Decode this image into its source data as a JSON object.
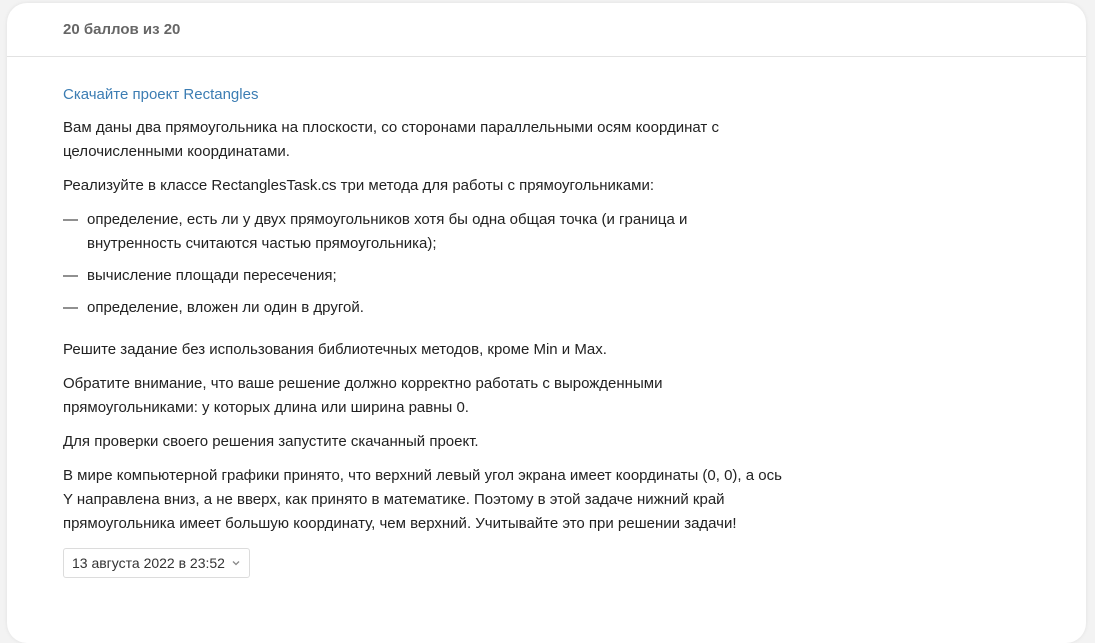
{
  "header": {
    "score": "20 баллов из 20"
  },
  "task": {
    "download_link": "Скачайте проект Rectangles",
    "paragraphs_top": [
      "Вам даны два прямоугольника на плоскости, со сторонами параллельными осям координат с целочисленными координатами.",
      "Реализуйте в классе RectanglesTask.cs три метода для работы с прямоугольниками:"
    ],
    "list_marker": "—",
    "list": [
      "определение, есть ли у двух прямоугольников хотя бы одна общая точка (и граница и внутренность считаются частью прямоугольника);",
      "вычисление площади пересечения;",
      "определение, вложен ли один в другой."
    ],
    "paragraphs_bottom": [
      "Решите задание без использования библиотечных методов, кроме Min и Max.",
      "Обратите внимание, что ваше решение должно корректно работать с вырожденными прямоугольниками: у которых длина или ширина равны 0.",
      "Для проверки своего решения запустите скачанный проект.",
      "В мире компьютерной графики принято, что верхний левый угол экрана имеет координаты (0, 0), а ось Y направлена вниз, а не вверх, как принято в математике. Поэтому в этой задаче нижний край прямоугольника имеет большую координату, чем верхний. Учитывайте это при решении задачи!"
    ]
  },
  "submission": {
    "date": "13 августа 2022 в 23:52",
    "icon": "chevron-down-icon"
  },
  "colors": {
    "link": "#3c7db3",
    "background": "#f3f3f3",
    "card": "#ffffff"
  }
}
